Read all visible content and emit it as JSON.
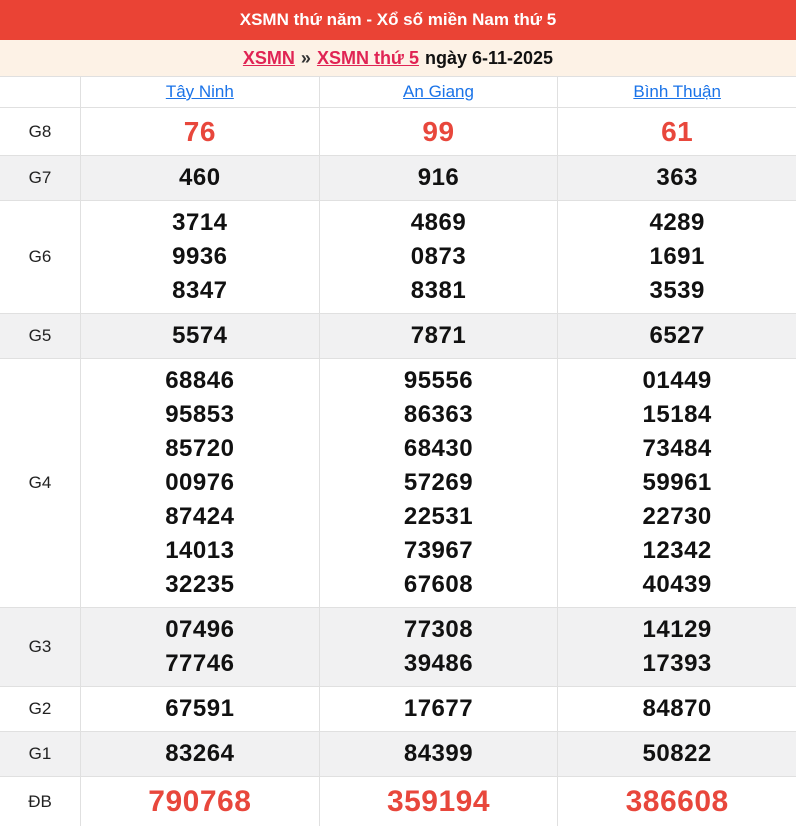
{
  "header": {
    "title": "XSMN thứ năm - Xổ số miền Nam thứ 5",
    "bg_color": "#EA4335"
  },
  "breadcrumb": {
    "link1": "XSMN",
    "separator": "»",
    "link2": "XSMN thứ 5",
    "suffix": "ngày 6-11-2025",
    "link_color": "#E02454"
  },
  "table": {
    "province_link_color": "#1A73E8",
    "highlight_color": "#E8473C",
    "provinces": [
      "Tây Ninh",
      "An Giang",
      "Bình Thuận"
    ],
    "rows": [
      {
        "label": "G8",
        "style": "red-large",
        "striped": false,
        "values": [
          [
            "76"
          ],
          [
            "99"
          ],
          [
            "61"
          ]
        ]
      },
      {
        "label": "G7",
        "style": "",
        "striped": true,
        "values": [
          [
            "460"
          ],
          [
            "916"
          ],
          [
            "363"
          ]
        ]
      },
      {
        "label": "G6",
        "style": "",
        "striped": false,
        "values": [
          [
            "3714",
            "9936",
            "8347"
          ],
          [
            "4869",
            "0873",
            "8381"
          ],
          [
            "4289",
            "1691",
            "3539"
          ]
        ]
      },
      {
        "label": "G5",
        "style": "",
        "striped": true,
        "values": [
          [
            "5574"
          ],
          [
            "7871"
          ],
          [
            "6527"
          ]
        ]
      },
      {
        "label": "G4",
        "style": "",
        "striped": false,
        "values": [
          [
            "68846",
            "95853",
            "85720",
            "00976",
            "87424",
            "14013",
            "32235"
          ],
          [
            "95556",
            "86363",
            "68430",
            "57269",
            "22531",
            "73967",
            "67608"
          ],
          [
            "01449",
            "15184",
            "73484",
            "59961",
            "22730",
            "12342",
            "40439"
          ]
        ]
      },
      {
        "label": "G3",
        "style": "",
        "striped": true,
        "values": [
          [
            "07496",
            "77746"
          ],
          [
            "77308",
            "39486"
          ],
          [
            "14129",
            "17393"
          ]
        ]
      },
      {
        "label": "G2",
        "style": "",
        "striped": false,
        "values": [
          [
            "67591"
          ],
          [
            "17677"
          ],
          [
            "84870"
          ]
        ]
      },
      {
        "label": "G1",
        "style": "",
        "striped": true,
        "values": [
          [
            "83264"
          ],
          [
            "84399"
          ],
          [
            "50822"
          ]
        ]
      },
      {
        "label": "ĐB",
        "style": "red-xlarge",
        "striped": false,
        "values": [
          [
            "790768"
          ],
          [
            "359194"
          ],
          [
            "386608"
          ]
        ]
      }
    ]
  }
}
